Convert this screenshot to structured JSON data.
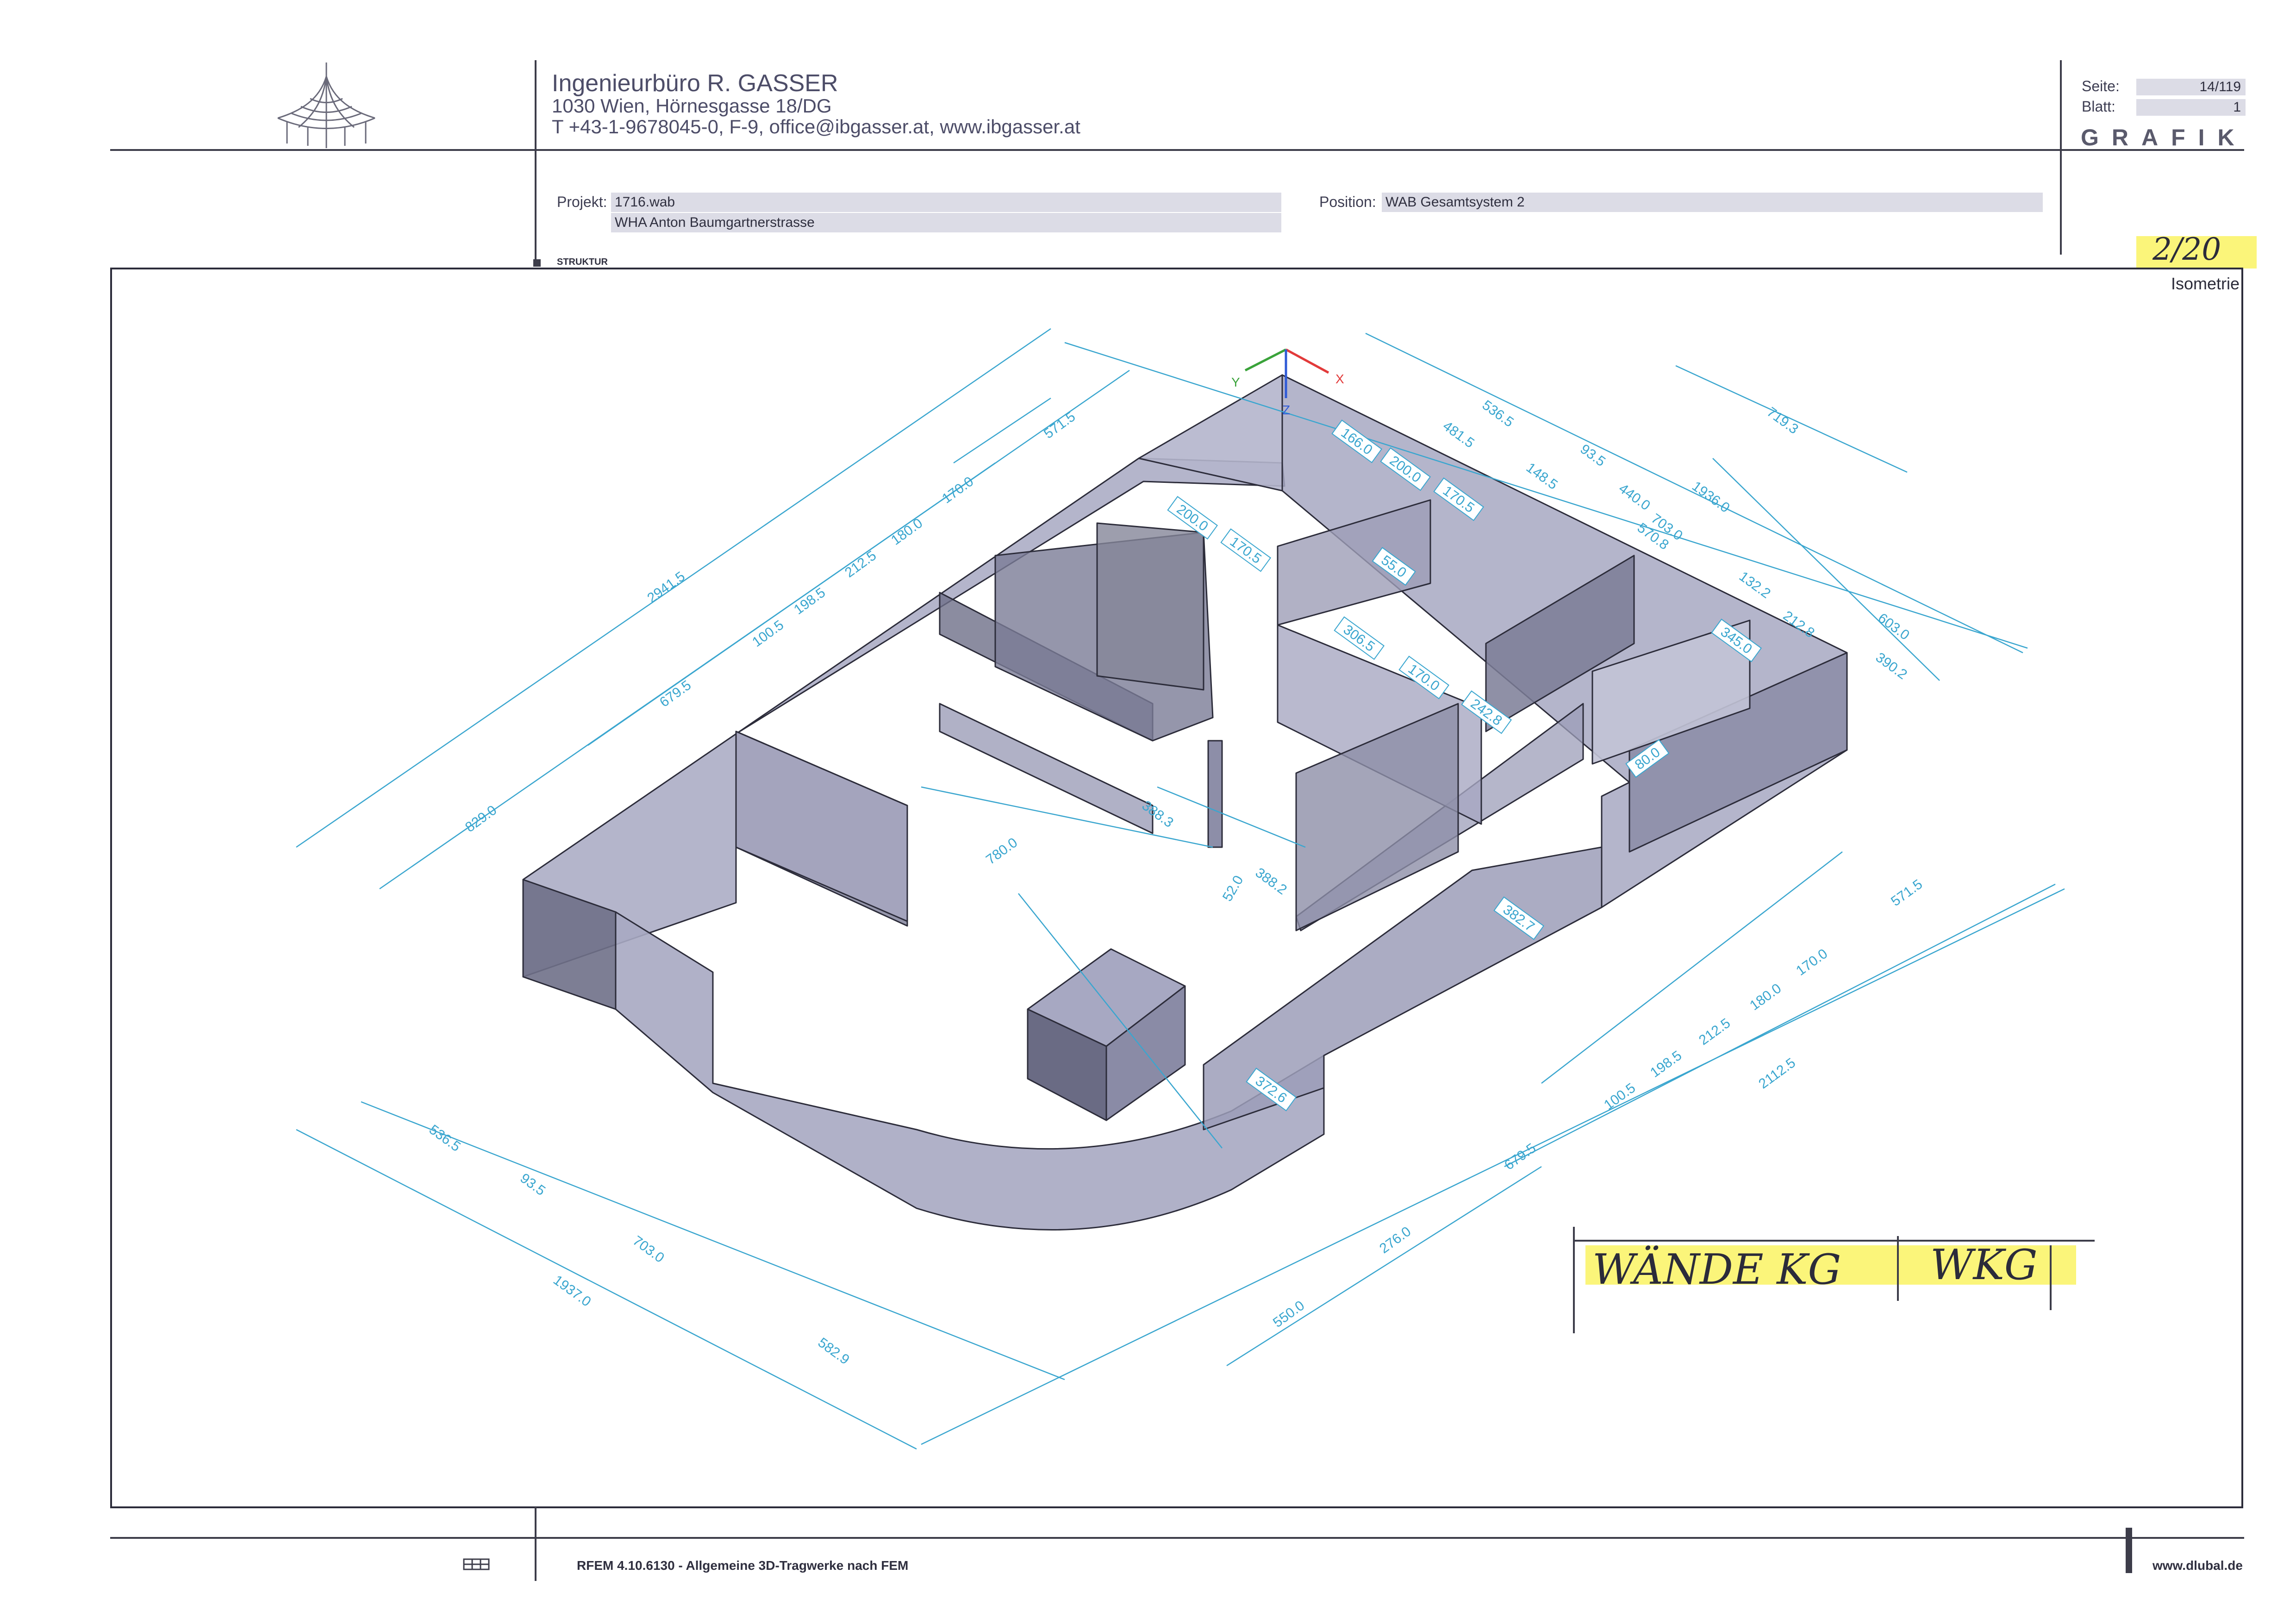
{
  "header": {
    "company_name": "Ingenieurbüro R. GASSER",
    "address": "1030 Wien, Hörnesgasse 18/DG",
    "contact": "T +43-1-9678045-0,  F-9,  office@ibgasser.at,  www.ibgasser.at",
    "seite_label": "Seite:",
    "seite_value": "14/119",
    "blatt_label": "Blatt:",
    "blatt_value": "1",
    "section_title": "GRAFIK"
  },
  "project": {
    "projekt_label": "Projekt:",
    "projekt_file": "1716.wab",
    "projekt_name": "WHA Anton Baumgartnerstrasse",
    "position_label": "Position:",
    "position_value": "WAB Gesamtsystem 2",
    "struktur_label": "STRUKTUR"
  },
  "annotations": {
    "handwritten_sheet": "2/20",
    "handwritten_title_left": "WÄNDE KG",
    "handwritten_title_right": "WKG"
  },
  "drawing": {
    "view_label": "Isometrie",
    "axes": {
      "x": "X",
      "y": "Y",
      "z": "Z"
    },
    "dimension_labels": [
      "2941.5",
      "571.5",
      "679.5",
      "829.0",
      "100.5",
      "198.5",
      "212.5",
      "180.0",
      "170.0",
      "166.0",
      "200.0",
      "170.5",
      "200.0",
      "170.5",
      "55.0",
      "306.5",
      "170.0",
      "242.8",
      "536.5",
      "481.5",
      "93.5",
      "148.5",
      "440.0",
      "703.0",
      "570.8",
      "719.3",
      "1936.0",
      "132.2",
      "212.8",
      "603.0",
      "390.2",
      "345.0",
      "80.0",
      "780.0",
      "388.3",
      "388.2",
      "52.0",
      "382.7",
      "571.5",
      "100.5",
      "198.5",
      "212.5",
      "180.0",
      "170.0",
      "2112.5",
      "372.6",
      "679.5",
      "276.0",
      "550.0",
      "536.5",
      "93.5",
      "703.0",
      "1937.0",
      "582.9"
    ],
    "colors": {
      "dimension": "#3aa6cf",
      "wall_fill": "#a7a8c2",
      "wall_dark": "#7c7d95",
      "outline": "#2c2c3a",
      "highlight": "#fbf57a"
    }
  },
  "footer": {
    "software": "RFEM 4.10.6130 - Allgemeine 3D-Tragwerke nach FEM",
    "website": "www.dlubal.de"
  }
}
